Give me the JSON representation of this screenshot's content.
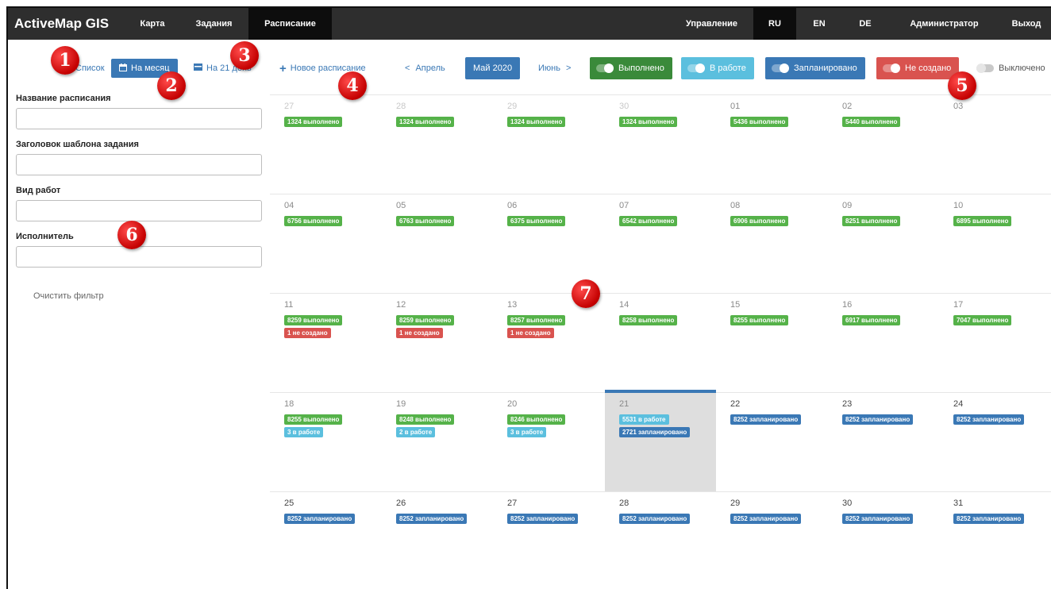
{
  "nav": {
    "brand": "ActiveMap GIS",
    "items": [
      "Карта",
      "Задания",
      "Расписание"
    ],
    "right_items": [
      "Управление",
      "RU",
      "EN",
      "DE",
      "Администратор",
      "Выход"
    ]
  },
  "sidebar": {
    "tabs": [
      "Список",
      "На месяц",
      "На 21 день"
    ],
    "fields": [
      {
        "label": "Название расписания",
        "value": ""
      },
      {
        "label": "Заголовок шаблона задания",
        "value": ""
      },
      {
        "label": "Вид работ",
        "value": ""
      },
      {
        "label": "Исполнитель",
        "value": ""
      }
    ],
    "clear_filter": "Очистить фильтр"
  },
  "toolbar": {
    "new_schedule": "Новое расписание",
    "prev_month": "Апрель",
    "current_month": "Май 2020",
    "next_month": "Июнь",
    "statuses": [
      {
        "label": "Выполнено",
        "color": "#3a8a3a",
        "on": true
      },
      {
        "label": "В работе",
        "color": "#5bbfde",
        "on": true
      },
      {
        "label": "Запланировано",
        "color": "#3a78b5",
        "on": true
      },
      {
        "label": "Не создано",
        "color": "#d9534f",
        "on": true
      },
      {
        "label": "Выключено",
        "color": "",
        "on": false
      }
    ]
  },
  "calendar": {
    "weeks": [
      [
        {
          "day": "27",
          "badges": [
            "1324 выполнено"
          ]
        },
        {
          "day": "28",
          "badges": [
            "1324 выполнено"
          ]
        },
        {
          "day": "29",
          "badges": [
            "1324 выполнено"
          ]
        },
        {
          "day": "30",
          "badges": [
            "1324 выполнено"
          ]
        },
        {
          "day": "01",
          "badges": [
            "5436 выполнено"
          ]
        },
        {
          "day": "02",
          "badges": [
            "5440 выполнено"
          ]
        },
        {
          "day": "03",
          "badges": []
        }
      ],
      [
        {
          "day": "04",
          "badges": [
            "6756 выполнено"
          ]
        },
        {
          "day": "05",
          "badges": [
            "6763 выполнено"
          ]
        },
        {
          "day": "06",
          "badges": [
            "6375 выполнено"
          ]
        },
        {
          "day": "07",
          "badges": [
            "6542 выполнено"
          ]
        },
        {
          "day": "08",
          "badges": [
            "6906 выполнено"
          ]
        },
        {
          "day": "09",
          "badges": [
            "8251 выполнено"
          ]
        },
        {
          "day": "10",
          "badges": [
            "6895 выполнено"
          ]
        }
      ],
      [
        {
          "day": "11",
          "badges": [
            "8259 выполнено",
            "1 не создано"
          ]
        },
        {
          "day": "12",
          "badges": [
            "8259 выполнено",
            "1 не создано"
          ]
        },
        {
          "day": "13",
          "badges": [
            "8257 выполнено",
            "1 не создано"
          ]
        },
        {
          "day": "14",
          "badges": [
            "8258 выполнено"
          ]
        },
        {
          "day": "15",
          "badges": [
            "8255 выполнено"
          ]
        },
        {
          "day": "16",
          "badges": [
            "6917 выполнено"
          ]
        },
        {
          "day": "17",
          "badges": [
            "7047 выполнено"
          ]
        }
      ],
      [
        {
          "day": "18",
          "badges": [
            "8255 выполнено",
            "3 в работе"
          ]
        },
        {
          "day": "19",
          "badges": [
            "8248 выполнено",
            "2 в работе"
          ]
        },
        {
          "day": "20",
          "badges": [
            "8246 выполнено",
            "3 в работе"
          ]
        },
        {
          "day": "21",
          "badges": [
            "5531 в работе",
            "2721 запланировано"
          ]
        },
        {
          "day": "22",
          "badges": [
            "8252 запланировано"
          ]
        },
        {
          "day": "23",
          "badges": [
            "8252 запланировано"
          ]
        },
        {
          "day": "24",
          "badges": [
            "8252 запланировано"
          ]
        }
      ],
      [
        {
          "day": "25",
          "badges": [
            "8252 запланировано"
          ]
        },
        {
          "day": "26",
          "badges": [
            "8252 запланировано"
          ]
        },
        {
          "day": "27",
          "badges": [
            "8252 запланировано"
          ]
        },
        {
          "day": "28",
          "badges": [
            "8252 запланировано"
          ]
        },
        {
          "day": "29",
          "badges": [
            "8252 запланировано"
          ]
        },
        {
          "day": "30",
          "badges": [
            "8252 запланировано"
          ]
        },
        {
          "day": "31",
          "badges": [
            "8252 запланировано"
          ]
        }
      ]
    ],
    "today": "21"
  },
  "markers": [
    "1",
    "2",
    "3",
    "4",
    "5",
    "6",
    "7"
  ],
  "colors": {
    "nav_bg": "#2e2e2e",
    "accent": "#3a78b5",
    "done": "#55b249",
    "in_progress": "#5bbfde",
    "planned": "#3a78b5",
    "not_created": "#d9534f",
    "marker": "#d40000"
  },
  "icons": [
    "list-icon",
    "calendar-icon",
    "calendar-range-icon",
    "plus-icon",
    "chevron-left-icon",
    "chevron-right-icon",
    "toggle-icon"
  ]
}
